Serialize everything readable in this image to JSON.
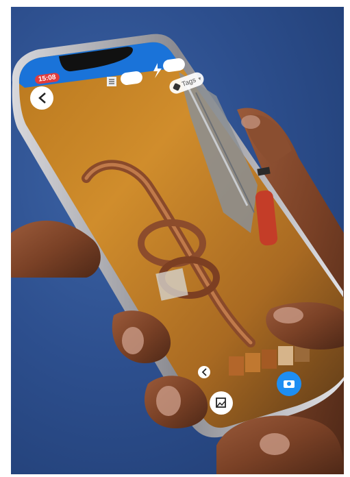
{
  "status_bar": {
    "time": "15:08"
  },
  "camera_ui": {
    "tags_label": "Tags",
    "accent_color": "#1e8ef2",
    "status_bar_color": "#1a73d9"
  },
  "icons": [
    "back-arrow-icon",
    "list-icon",
    "flash-icon",
    "tag-icon",
    "gallery-icon",
    "camera-icon",
    "back-chevron-icon"
  ]
}
